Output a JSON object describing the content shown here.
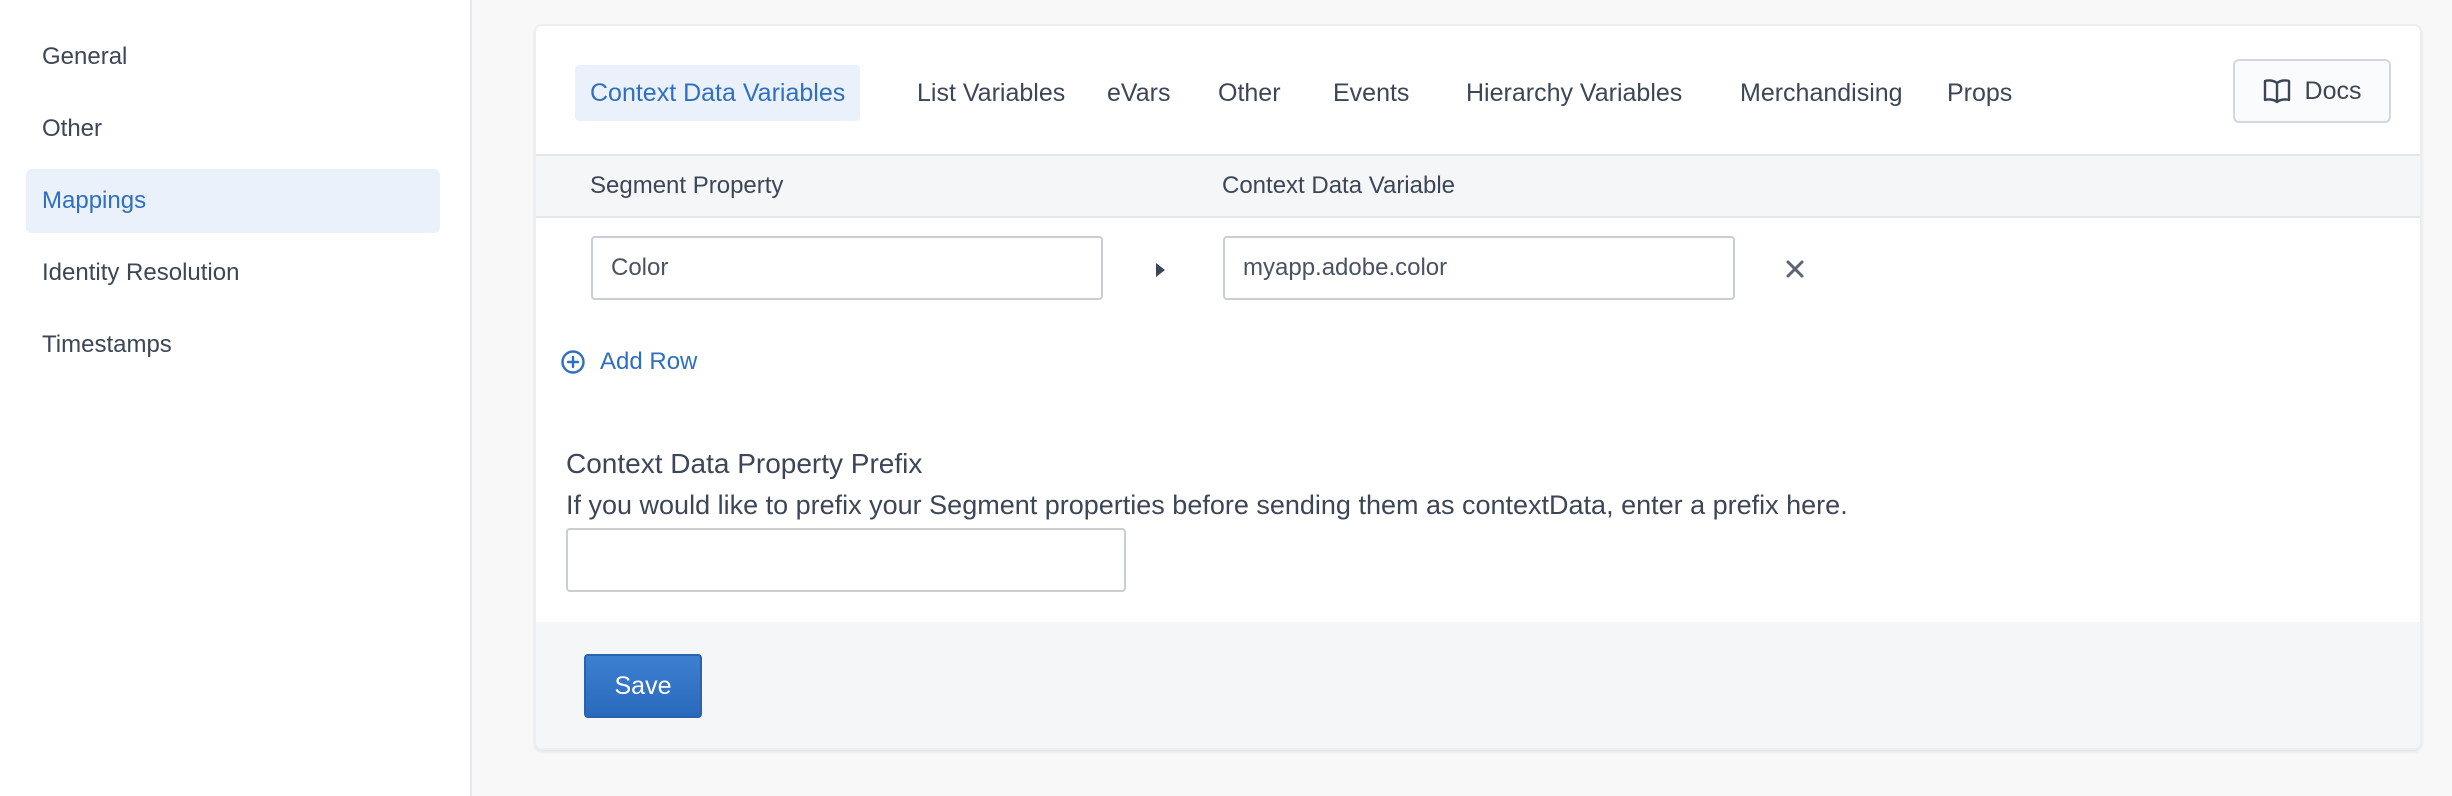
{
  "sidebar": {
    "items": [
      {
        "label": "General",
        "active": false
      },
      {
        "label": "Other",
        "active": false
      },
      {
        "label": "Mappings",
        "active": true
      },
      {
        "label": "Identity Resolution",
        "active": false
      },
      {
        "label": "Timestamps",
        "active": false
      }
    ]
  },
  "tabs": [
    {
      "label": "Context Data Variables",
      "active": true
    },
    {
      "label": "List Variables",
      "active": false
    },
    {
      "label": "eVars",
      "active": false
    },
    {
      "label": "Other",
      "active": false
    },
    {
      "label": "Events",
      "active": false
    },
    {
      "label": "Hierarchy Variables",
      "active": false
    },
    {
      "label": "Merchandising",
      "active": false
    },
    {
      "label": "Props",
      "active": false
    }
  ],
  "docs_button": {
    "label": "Docs",
    "icon": "book-icon"
  },
  "table": {
    "headers": [
      "Segment Property",
      "Context Data Variable"
    ],
    "rows": [
      {
        "segment_property": "Color",
        "context_data_variable": "myapp.adobe.color"
      }
    ],
    "add_row_label": "Add Row"
  },
  "prefix": {
    "title": "Context Data Property Prefix",
    "description": "If you would like to prefix your Segment properties before sending them as contextData, enter a prefix here.",
    "value": ""
  },
  "save_button": {
    "label": "Save"
  },
  "colors": {
    "accent": "#2f6fc0",
    "active_bg": "#ebf1fa",
    "save_bg": "#2f6fc0"
  }
}
